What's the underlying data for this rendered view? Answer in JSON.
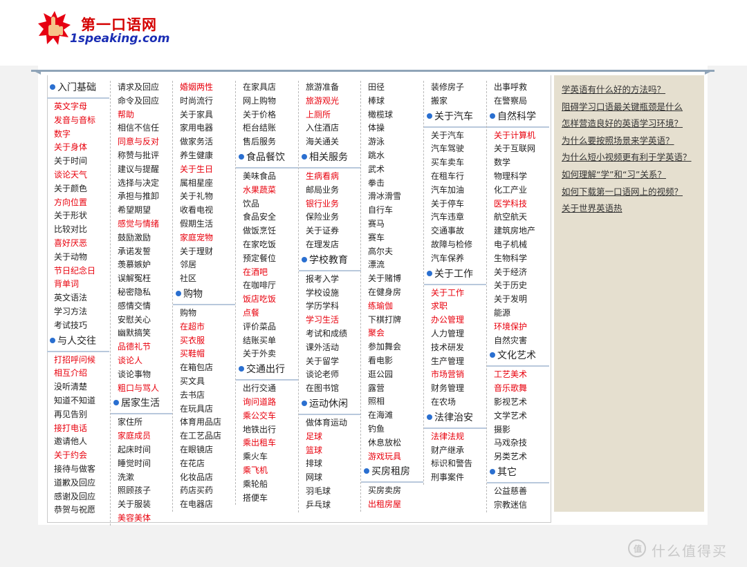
{
  "logo": {
    "cn": "第一口语网",
    "en": "1speaking.com"
  },
  "columns": [
    [
      {
        "h": "入门基础"
      },
      {
        "t": "英文字母",
        "r": 1
      },
      {
        "t": "发音与音标",
        "r": 1
      },
      {
        "t": "数字",
        "r": 1
      },
      {
        "t": "关于身体",
        "r": 1
      },
      {
        "t": "关于时间"
      },
      {
        "t": "谈论天气",
        "r": 1
      },
      {
        "t": "关于颜色"
      },
      {
        "t": "方向位置",
        "r": 1
      },
      {
        "t": "关于形状"
      },
      {
        "t": "比较对比"
      },
      {
        "t": "喜好厌恶",
        "r": 1
      },
      {
        "t": "关于动物"
      },
      {
        "t": "节日纪念日",
        "r": 1
      },
      {
        "t": "背单词",
        "r": 1
      },
      {
        "t": "英文语法"
      },
      {
        "t": "学习方法"
      },
      {
        "t": "考试技巧"
      },
      {
        "h": "与人交往"
      },
      {
        "t": "打招呼问候",
        "r": 1
      },
      {
        "t": "相互介绍",
        "r": 1
      },
      {
        "t": "没听清楚"
      },
      {
        "t": "知道不知道"
      },
      {
        "t": "再见告别"
      },
      {
        "t": "接打电话",
        "r": 1
      },
      {
        "t": "邀请他人"
      },
      {
        "t": "关于约会",
        "r": 1
      },
      {
        "t": "接待与做客"
      },
      {
        "t": "道歉及回应"
      },
      {
        "t": "感谢及回应"
      },
      {
        "t": "恭贺与祝愿"
      }
    ],
    [
      {
        "t": "请求及回应"
      },
      {
        "t": "命令及回应"
      },
      {
        "t": "帮助",
        "r": 1
      },
      {
        "t": "相信不信任"
      },
      {
        "t": "同意与反对",
        "r": 1
      },
      {
        "t": "称赞与批评"
      },
      {
        "t": "建议与提醒"
      },
      {
        "t": "选择与决定"
      },
      {
        "t": "承担与推卸"
      },
      {
        "t": "希望期望"
      },
      {
        "t": "感觉与情绪",
        "r": 1
      },
      {
        "t": "鼓励激励"
      },
      {
        "t": "承诺发誓"
      },
      {
        "t": "羡慕嫉妒"
      },
      {
        "t": "误解冤枉"
      },
      {
        "t": "秘密隐私"
      },
      {
        "t": "感情交情"
      },
      {
        "t": "安慰关心"
      },
      {
        "t": "幽默搞笑"
      },
      {
        "t": "品德礼节",
        "r": 1
      },
      {
        "t": "谈论人",
        "r": 1
      },
      {
        "t": "谈论事物"
      },
      {
        "t": "粗口与骂人",
        "r": 1
      },
      {
        "h": "居家生活"
      },
      {
        "t": "家住所"
      },
      {
        "t": "家庭成员",
        "r": 1
      },
      {
        "t": "起床时间"
      },
      {
        "t": "睡觉时间"
      },
      {
        "t": "洗漱"
      },
      {
        "t": "照顾孩子"
      },
      {
        "t": "关于服装"
      },
      {
        "t": "美容美体",
        "r": 1
      }
    ],
    [
      {
        "t": "婚姻两性",
        "r": 1
      },
      {
        "t": "时尚流行"
      },
      {
        "t": "关于家具"
      },
      {
        "t": "家用电器"
      },
      {
        "t": "做家务活"
      },
      {
        "t": "养生健康"
      },
      {
        "t": "关于生日",
        "r": 1
      },
      {
        "t": "属相星座"
      },
      {
        "t": "关于礼物"
      },
      {
        "t": "收看电视"
      },
      {
        "t": "假期生活"
      },
      {
        "t": "家庭宠物",
        "r": 1
      },
      {
        "t": "关于理财"
      },
      {
        "t": "邻居"
      },
      {
        "t": "社区"
      },
      {
        "h": "购物"
      },
      {
        "t": "购物"
      },
      {
        "t": "在超市",
        "r": 1
      },
      {
        "t": "买衣服",
        "r": 1
      },
      {
        "t": "买鞋帽",
        "r": 1
      },
      {
        "t": "在箱包店"
      },
      {
        "t": "买文具"
      },
      {
        "t": "去书店"
      },
      {
        "t": "在玩具店"
      },
      {
        "t": "体育用品店"
      },
      {
        "t": "在工艺品店"
      },
      {
        "t": "在眼镜店"
      },
      {
        "t": "在花店"
      },
      {
        "t": "化妆品店"
      },
      {
        "t": "药店买药"
      },
      {
        "t": "在电器店"
      }
    ],
    [
      {
        "t": "在家具店"
      },
      {
        "t": "网上购物"
      },
      {
        "t": "关于价格"
      },
      {
        "t": "柜台结账"
      },
      {
        "t": "售后服务"
      },
      {
        "h": "食品餐饮"
      },
      {
        "t": "美味食品"
      },
      {
        "t": "水果蔬菜",
        "r": 1
      },
      {
        "t": "饮品"
      },
      {
        "t": "食品安全"
      },
      {
        "t": "做饭烹饪"
      },
      {
        "t": "在家吃饭"
      },
      {
        "t": "预定餐位"
      },
      {
        "t": "在酒吧",
        "r": 1
      },
      {
        "t": "在咖啡厅"
      },
      {
        "t": "饭店吃饭",
        "r": 1
      },
      {
        "t": "点餐",
        "r": 1
      },
      {
        "t": "评价菜品"
      },
      {
        "t": "结账买单"
      },
      {
        "t": "关于外卖"
      },
      {
        "h": "交通出行"
      },
      {
        "t": "出行交通"
      },
      {
        "t": "询问道路",
        "r": 1
      },
      {
        "t": "乘公交车",
        "r": 1
      },
      {
        "t": "地铁出行"
      },
      {
        "t": "乘出租车",
        "r": 1
      },
      {
        "t": "乘火车"
      },
      {
        "t": "乘飞机",
        "r": 1
      },
      {
        "t": "乘轮船"
      },
      {
        "t": "搭便车"
      }
    ],
    [
      {
        "t": "旅游准备"
      },
      {
        "t": "旅游观光",
        "r": 1
      },
      {
        "t": "上厕所",
        "r": 1
      },
      {
        "t": "入住酒店"
      },
      {
        "t": "海关通关"
      },
      {
        "h": "相关服务"
      },
      {
        "t": "生病看病",
        "r": 1
      },
      {
        "t": "邮局业务"
      },
      {
        "t": "银行业务",
        "r": 1
      },
      {
        "t": "保险业务"
      },
      {
        "t": "关于证券"
      },
      {
        "t": "在理发店"
      },
      {
        "h": "学校教育"
      },
      {
        "t": "报考入学"
      },
      {
        "t": "学校设施"
      },
      {
        "t": "学历学科"
      },
      {
        "t": "学习生活",
        "r": 1
      },
      {
        "t": "考试和成绩"
      },
      {
        "t": "课外活动"
      },
      {
        "t": "关于留学"
      },
      {
        "t": "谈论老师"
      },
      {
        "t": "在图书馆"
      },
      {
        "h": "运动休闲"
      },
      {
        "t": "做体育运动"
      },
      {
        "t": "足球",
        "r": 1
      },
      {
        "t": "篮球",
        "r": 1
      },
      {
        "t": "排球"
      },
      {
        "t": "网球"
      },
      {
        "t": "羽毛球"
      },
      {
        "t": "乒乓球"
      }
    ],
    [
      {
        "t": "田径"
      },
      {
        "t": "棒球"
      },
      {
        "t": "橄榄球"
      },
      {
        "t": "体操"
      },
      {
        "t": "游泳"
      },
      {
        "t": "跳水"
      },
      {
        "t": "武术"
      },
      {
        "t": "拳击"
      },
      {
        "t": "滑冰滑雪"
      },
      {
        "t": "自行车"
      },
      {
        "t": "赛马"
      },
      {
        "t": "赛车"
      },
      {
        "t": "高尔夫"
      },
      {
        "t": "漂流"
      },
      {
        "t": "关于赌博"
      },
      {
        "t": "在健身房"
      },
      {
        "t": "练瑜伽",
        "r": 1
      },
      {
        "t": "下棋打牌"
      },
      {
        "t": "聚会",
        "r": 1
      },
      {
        "t": "参加舞会"
      },
      {
        "t": "看电影"
      },
      {
        "t": "逛公园"
      },
      {
        "t": "露营"
      },
      {
        "t": "照相"
      },
      {
        "t": "在海滩"
      },
      {
        "t": "钓鱼"
      },
      {
        "t": "休息放松"
      },
      {
        "t": "游戏玩具",
        "r": 1
      },
      {
        "h": "买房租房"
      },
      {
        "t": "买房卖房"
      },
      {
        "t": "出租房屋",
        "r": 1
      }
    ],
    [
      {
        "t": "装修房子"
      },
      {
        "t": "搬家"
      },
      {
        "h": "关于汽车"
      },
      {
        "t": "关于汽车"
      },
      {
        "t": "汽车驾驶"
      },
      {
        "t": "买车卖车"
      },
      {
        "t": "在租车行"
      },
      {
        "t": "汽车加油"
      },
      {
        "t": "关于停车"
      },
      {
        "t": "汽车违章"
      },
      {
        "t": "交通事故"
      },
      {
        "t": "故障与检修"
      },
      {
        "t": "汽车保养"
      },
      {
        "h": "关于工作"
      },
      {
        "t": "关于工作",
        "r": 1
      },
      {
        "t": "求职",
        "r": 1
      },
      {
        "t": "办公管理",
        "r": 1
      },
      {
        "t": "人力管理"
      },
      {
        "t": "技术研发"
      },
      {
        "t": "生产管理"
      },
      {
        "t": "市场营销",
        "r": 1
      },
      {
        "t": "财务管理"
      },
      {
        "t": "在农场"
      },
      {
        "h": "法律治安"
      },
      {
        "t": "法律法规",
        "r": 1
      },
      {
        "t": "财产继承"
      },
      {
        "t": "标识和警告"
      },
      {
        "t": "刑事案件"
      }
    ],
    [
      {
        "t": "出事呼救"
      },
      {
        "t": "在警察局"
      },
      {
        "h": "自然科学"
      },
      {
        "t": "关于计算机",
        "r": 1
      },
      {
        "t": "关于互联网"
      },
      {
        "t": "数学"
      },
      {
        "t": "物理科学"
      },
      {
        "t": "化工产业"
      },
      {
        "t": "医学科技",
        "r": 1
      },
      {
        "t": "航空航天"
      },
      {
        "t": "建筑房地产"
      },
      {
        "t": "电子机械"
      },
      {
        "t": "生物科学"
      },
      {
        "t": "关于经济"
      },
      {
        "t": "关于历史"
      },
      {
        "t": "关于发明"
      },
      {
        "t": "能源"
      },
      {
        "t": "环境保护",
        "r": 1
      },
      {
        "t": "自然灾害"
      },
      {
        "h": "文化艺术"
      },
      {
        "t": "工艺美术",
        "r": 1
      },
      {
        "t": "音乐歌舞",
        "r": 1
      },
      {
        "t": "影视艺术"
      },
      {
        "t": "文学艺术"
      },
      {
        "t": "摄影"
      },
      {
        "t": "马戏杂技"
      },
      {
        "t": "另类艺术"
      },
      {
        "h": "其它"
      },
      {
        "t": "公益慈善"
      },
      {
        "t": "宗教迷信"
      }
    ]
  ],
  "sidebar": {
    "questions": [
      "学英语有什么好的方法吗？",
      "阻碍学习口语最关键瓶颈是什么",
      "怎样营造良好的英语学习环境？",
      "为什么要按照场景来学英语？",
      "为什么短小视频更有利于学英语？",
      "如何理解“学”和“习”关系？",
      "如何下载第一口语网上的视频？",
      "关于世界英语热"
    ]
  },
  "watermark": {
    "mark": "值",
    "text": "什么值得买"
  },
  "colors": {
    "red": "#e8000c",
    "text": "#222222",
    "accent": "#2a6fd0",
    "sidebar_bg": "#e5dfcf"
  }
}
